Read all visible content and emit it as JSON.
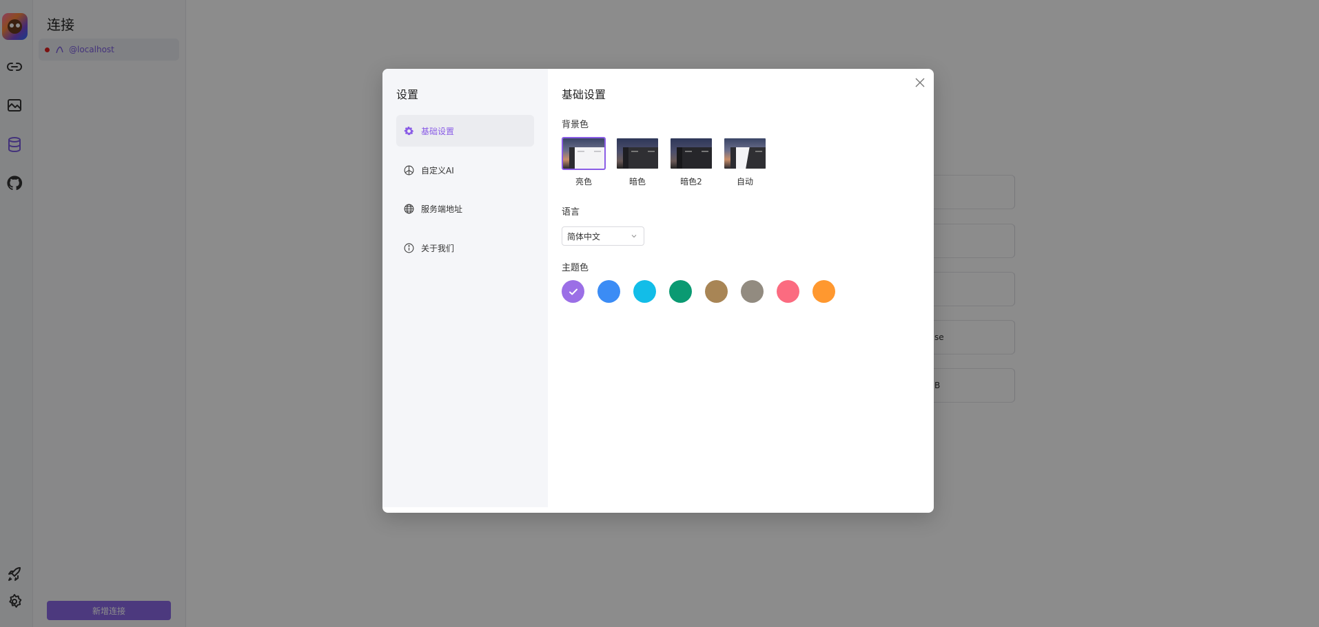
{
  "app": {
    "connections_title": "连接",
    "connection_item": "@localhost",
    "new_connection_button": "新增连接",
    "background_cards": [
      "",
      "",
      "",
      "se",
      "B"
    ]
  },
  "modal": {
    "title": "设置",
    "menu": [
      {
        "label": "基础设置",
        "icon": "gear-icon",
        "active": true
      },
      {
        "label": "自定义AI",
        "icon": "openai-icon",
        "active": false
      },
      {
        "label": "服务端地址",
        "icon": "globe-icon",
        "active": false
      },
      {
        "label": "关于我们",
        "icon": "info-icon",
        "active": false
      }
    ],
    "content": {
      "title": "基础设置",
      "background_section": "背景色",
      "background_options": [
        {
          "label": "亮色",
          "selected": true
        },
        {
          "label": "暗色",
          "selected": false
        },
        {
          "label": "暗色2",
          "selected": false
        },
        {
          "label": "自动",
          "selected": false
        }
      ],
      "language_section": "语言",
      "language_value": "简体中文",
      "theme_section": "主题色",
      "theme_colors": [
        {
          "color": "#9b6fe6",
          "selected": true
        },
        {
          "color": "#3b8cf5",
          "selected": false
        },
        {
          "color": "#12bde8",
          "selected": false
        },
        {
          "color": "#0a9a72",
          "selected": false
        },
        {
          "color": "#a88555",
          "selected": false
        },
        {
          "color": "#928b80",
          "selected": false
        },
        {
          "color": "#fb6b80",
          "selected": false
        },
        {
          "color": "#ff982f",
          "selected": false
        }
      ]
    }
  }
}
